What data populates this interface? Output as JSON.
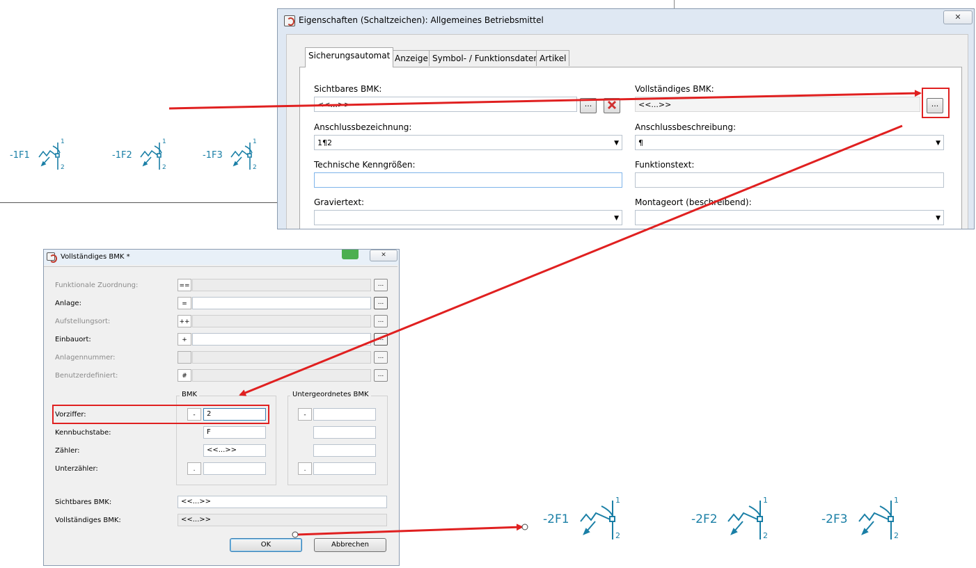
{
  "schematic_top": {
    "symbols": [
      {
        "label": "-1F1",
        "pin_top": "1",
        "pin_bottom": "2"
      },
      {
        "label": "-1F2",
        "pin_top": "1",
        "pin_bottom": "2"
      },
      {
        "label": "-1F3",
        "pin_top": "1",
        "pin_bottom": "2"
      }
    ]
  },
  "schematic_bottom": {
    "symbols": [
      {
        "label": "-2F1",
        "pin_top": "1",
        "pin_bottom": "2"
      },
      {
        "label": "-2F2",
        "pin_top": "1",
        "pin_bottom": "2"
      },
      {
        "label": "-2F3",
        "pin_top": "1",
        "pin_bottom": "2"
      }
    ]
  },
  "properties_dialog": {
    "title": "Eigenschaften (Schaltzeichen): Allgemeines Betriebsmittel",
    "close_glyph": "✕",
    "tabs": [
      "Sicherungsautomat",
      "Anzeige",
      "Symbol- / Funktionsdaten",
      "Artikel"
    ],
    "fields": {
      "sichtbares_bmk": {
        "label": "Sichtbares BMK:",
        "value": "<<...>>"
      },
      "vollstaendiges_bmk": {
        "label": "Vollständiges BMK:",
        "value": "<<...>>"
      },
      "anschlussbezeichnung": {
        "label": "Anschlussbezeichnung:",
        "value": "1¶2"
      },
      "anschlussbeschreibung": {
        "label": "Anschlussbeschreibung:",
        "value": "¶"
      },
      "technische_kenngroessen": {
        "label": "Technische Kenngrößen:",
        "value": ""
      },
      "funktionstext": {
        "label": "Funktionstext:",
        "value": ""
      },
      "graviertext": {
        "label": "Graviertext:",
        "value": ""
      },
      "montageort": {
        "label": "Montageort (beschreibend):",
        "value": ""
      }
    },
    "dots_label": "...",
    "dropdown_glyph": "▼"
  },
  "bmk_dialog": {
    "title": "Vollständiges BMK *",
    "close_glyph": "✕",
    "rows": [
      {
        "label": "Funktionale Zuordnung:",
        "prefix": "==",
        "value": "",
        "enabled": false
      },
      {
        "label": "Anlage:",
        "prefix": "=",
        "value": "",
        "enabled": true
      },
      {
        "label": "Aufstellungsort:",
        "prefix": "++",
        "value": "",
        "enabled": false
      },
      {
        "label": "Einbauort:",
        "prefix": "+",
        "value": "",
        "enabled": true
      },
      {
        "label": "Anlagennummer:",
        "prefix": "",
        "value": "",
        "enabled": false
      },
      {
        "label": "Benutzerdefiniert:",
        "prefix": "#",
        "value": "",
        "enabled": false
      }
    ],
    "dots_label": "...",
    "group_bmk": "BMK",
    "group_sub": "Untergeordnetes BMK",
    "vorziffer": {
      "label": "Vorziffer:",
      "prefix": "-",
      "value": "2",
      "sub_prefix": "-"
    },
    "kennbuchstabe": {
      "label": "Kennbuchstabe:",
      "value": "F"
    },
    "zaehler": {
      "label": "Zähler:",
      "value": "<<...>>"
    },
    "unterzaehler": {
      "label": "Unterzähler:",
      "prefix": ".",
      "sub_prefix": "."
    },
    "sichtbares_bmk": {
      "label": "Sichtbares BMK:",
      "value": "<<...>>"
    },
    "vollstaendiges_bmk": {
      "label": "Vollständiges BMK:",
      "value": "<<...>>"
    },
    "ok_label": "OK",
    "cancel_label": "Abbrechen"
  },
  "annotation_color": "#e02020",
  "symbol_color": "#1a7fa6"
}
